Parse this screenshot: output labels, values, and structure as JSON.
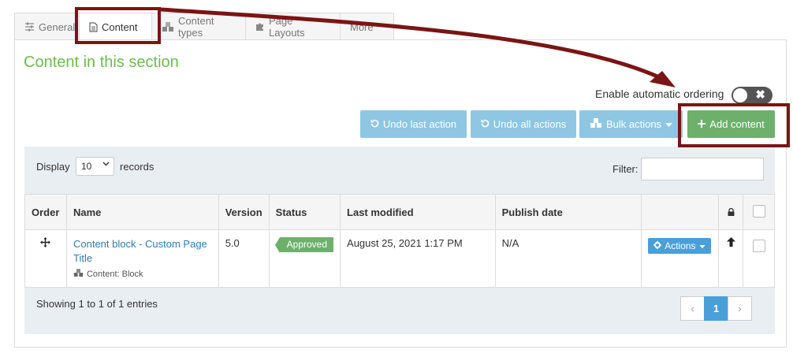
{
  "tabs": [
    {
      "label": "General",
      "icon": "sliders-icon"
    },
    {
      "label": "Content",
      "icon": "document-icon"
    },
    {
      "label": "Content types",
      "icon": "cubes-icon"
    },
    {
      "label": "Page Layouts",
      "icon": "puzzle-icon"
    },
    {
      "label": "More",
      "icon": ""
    }
  ],
  "section": {
    "title": "Content in this section"
  },
  "auto_ordering": {
    "label": "Enable automatic ordering",
    "enabled": false,
    "off_symbol": "✖"
  },
  "toolbar": {
    "undo_last": "Undo last action",
    "undo_all": "Undo all actions",
    "bulk": "Bulk actions",
    "add": "Add content"
  },
  "list_controls": {
    "display_label": "Display",
    "page_size": "10",
    "records_label": "records",
    "filter_label": "Filter:"
  },
  "table": {
    "columns": [
      "Order",
      "Name",
      "Version",
      "Status",
      "Last modified",
      "Publish date"
    ],
    "rows": [
      {
        "name": "Content block - Custom Page Title",
        "type": "Content: Block",
        "version": "5.0",
        "status": "Approved",
        "last_modified": "August 25, 2021 1:17 PM",
        "publish_date": "N/A",
        "actions": "Actions"
      }
    ]
  },
  "footer": {
    "entries": "Showing 1 to 1 of 1 entries"
  },
  "pagination": {
    "prev": "‹",
    "current": "1",
    "next": "›"
  },
  "colors": {
    "accent_green": "#6abf4b",
    "button_blue": "#8ec6e4",
    "add_green": "#6db06c",
    "annotation": "#7b1414"
  }
}
